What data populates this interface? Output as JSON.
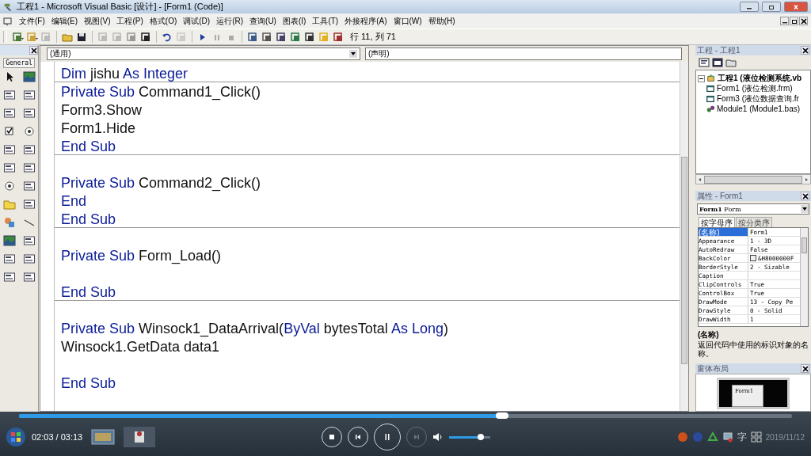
{
  "window": {
    "title": "工程1 - Microsoft Visual Basic [设计] - [Form1 (Code)]"
  },
  "menu": [
    "文件(F)",
    "编辑(E)",
    "视图(V)",
    "工程(P)",
    "格式(O)",
    "调试(D)",
    "运行(R)",
    "查询(U)",
    "图表(I)",
    "工具(T)",
    "外接程序(A)",
    "窗口(W)",
    "帮助(H)"
  ],
  "toolbar": {
    "position": "行 11, 列 71"
  },
  "toolbox": {
    "tab": "General"
  },
  "code": {
    "object_combo": "(通用)",
    "procedure_combo": "(声明)",
    "procedures": [
      {
        "lines": [
          {
            "kind": "code",
            "tokens": [
              {
                "text": "Dim",
                "kind": "keyword"
              },
              {
                "text": " jishu ",
                "kind": "plain"
              },
              {
                "text": "As Integer",
                "kind": "keyword"
              }
            ]
          }
        ]
      },
      {
        "lines": [
          {
            "kind": "code",
            "tokens": [
              {
                "text": "Private Sub",
                "kind": "keyword"
              },
              {
                "text": " Command1_Click()",
                "kind": "plain"
              }
            ]
          },
          {
            "kind": "code",
            "tokens": [
              {
                "text": "Form3.Show",
                "kind": "plain"
              }
            ]
          },
          {
            "kind": "code",
            "tokens": [
              {
                "text": "Form1.Hide",
                "kind": "plain"
              }
            ]
          },
          {
            "kind": "code",
            "tokens": [
              {
                "text": "End Sub",
                "kind": "keyword"
              }
            ]
          }
        ]
      },
      {
        "lines": [
          {
            "kind": "blank"
          },
          {
            "kind": "code",
            "tokens": [
              {
                "text": "Private Sub",
                "kind": "keyword"
              },
              {
                "text": " Command2_Click()",
                "kind": "plain"
              }
            ]
          },
          {
            "kind": "code",
            "tokens": [
              {
                "text": "End",
                "kind": "keyword"
              }
            ]
          },
          {
            "kind": "code",
            "tokens": [
              {
                "text": "End Sub",
                "kind": "keyword"
              }
            ]
          }
        ]
      },
      {
        "lines": [
          {
            "kind": "blank"
          },
          {
            "kind": "code",
            "tokens": [
              {
                "text": "Private Sub",
                "kind": "keyword"
              },
              {
                "text": " Form_Load()",
                "kind": "plain"
              }
            ]
          },
          {
            "kind": "blank"
          },
          {
            "kind": "code",
            "tokens": [
              {
                "text": "End Sub",
                "kind": "keyword"
              }
            ]
          }
        ]
      },
      {
        "lines": [
          {
            "kind": "blank"
          },
          {
            "kind": "code",
            "tokens": [
              {
                "text": "Private Sub",
                "kind": "keyword"
              },
              {
                "text": " Winsock1_DataArrival(",
                "kind": "plain"
              },
              {
                "text": "ByVal",
                "kind": "keyword"
              },
              {
                "text": " bytesTotal ",
                "kind": "plain"
              },
              {
                "text": "As Long",
                "kind": "keyword"
              },
              {
                "text": ")",
                "kind": "plain"
              }
            ]
          },
          {
            "kind": "code",
            "tokens": [
              {
                "text": "Winsock1.GetData data1",
                "kind": "plain"
              }
            ]
          },
          {
            "kind": "blank"
          },
          {
            "kind": "code",
            "tokens": [
              {
                "text": "End Sub",
                "kind": "keyword"
              }
            ]
          }
        ]
      }
    ]
  },
  "project": {
    "title": "工程 - 工程1",
    "tree": [
      {
        "label": "工程1 (液位检测系统.vb",
        "kind": "project",
        "expanded": true,
        "children": [
          {
            "label": "Form1 (液位检测.frm)",
            "kind": "form"
          },
          {
            "label": "Form3 (液位数据查询.fr",
            "kind": "form"
          },
          {
            "label": "Module1 (Module1.bas)",
            "kind": "module"
          }
        ]
      }
    ]
  },
  "properties": {
    "title": "属性 - Form1",
    "object": "**Form1** Form",
    "tabs": [
      {
        "label": "按字母序",
        "selected": true
      },
      {
        "label": "按分类序",
        "selected": false
      }
    ],
    "rows": [
      {
        "name": "(名称)",
        "value": "Form1",
        "selected": true,
        "kind": "text"
      },
      {
        "name": "Appearance",
        "value": "1 - 3D",
        "selected": false,
        "kind": "text"
      },
      {
        "name": "AutoRedraw",
        "value": "False",
        "selected": false,
        "kind": "text"
      },
      {
        "name": "BackColor",
        "value": "&H8000000F",
        "selected": false,
        "kind": "color"
      },
      {
        "name": "BorderStyle",
        "value": "2 - Sizable",
        "selected": false,
        "kind": "text"
      },
      {
        "name": "Caption",
        "selected": false,
        "kind": "empty"
      },
      {
        "name": "ClipControls",
        "value": "True",
        "selected": false,
        "kind": "text"
      },
      {
        "name": "ControlBox",
        "value": "True",
        "selected": false,
        "kind": "text"
      },
      {
        "name": "DrawMode",
        "value": "13 - Copy Pe",
        "selected": false,
        "kind": "text"
      },
      {
        "name": "DrawStyle",
        "value": "0 - Solid",
        "selected": false,
        "kind": "text"
      },
      {
        "name": "DrawWidth",
        "value": "1",
        "selected": false,
        "kind": "text"
      }
    ],
    "description": {
      "title": "(名称)",
      "text": "返回代码中使用的标识对象的名称。"
    }
  },
  "layout": {
    "title": "窗体布局",
    "form": "Form1"
  },
  "player": {
    "level": 0.625,
    "time": "02:03 / 03:13",
    "volume": {
      "level": 0.78
    },
    "next_disabled": true
  },
  "taskbar": {
    "ime": "字",
    "clock": "2019/11/12"
  }
}
